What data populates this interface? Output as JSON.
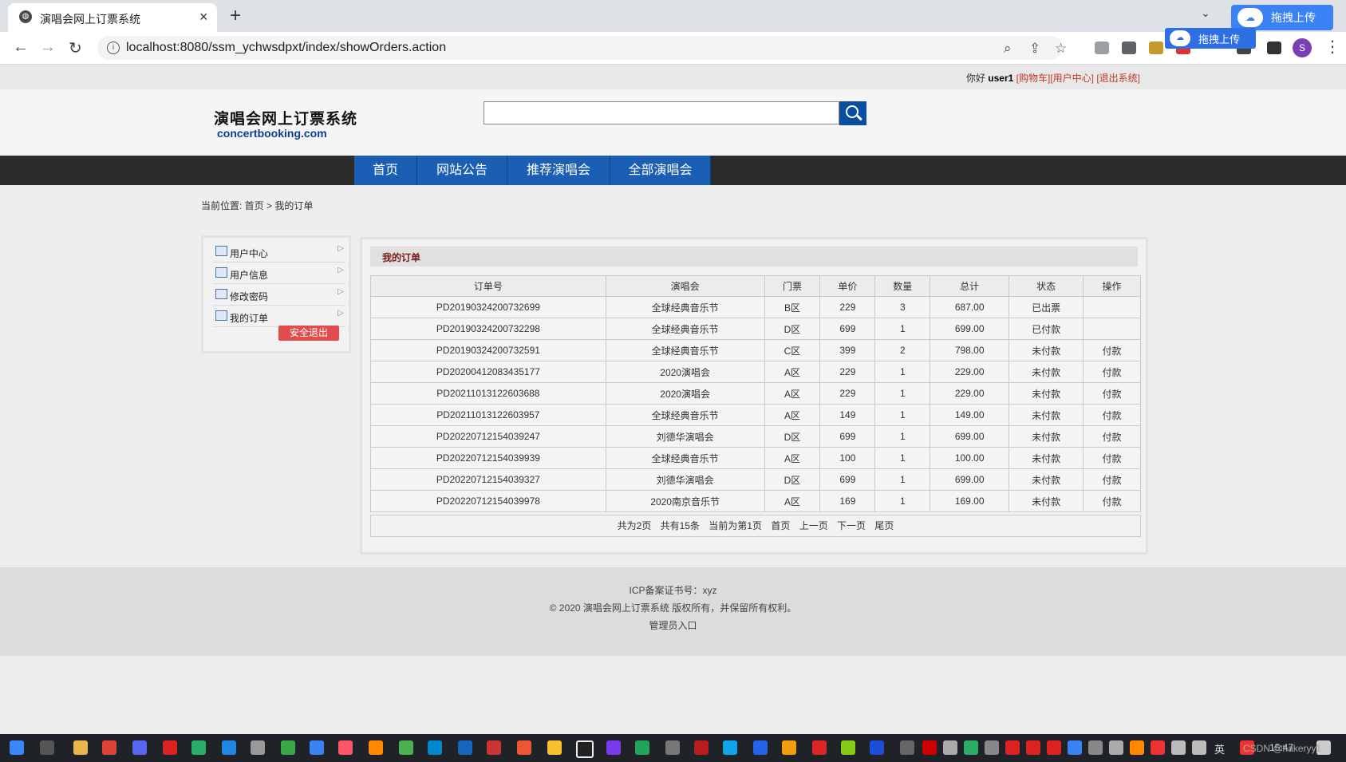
{
  "browser": {
    "tab_title": "演唱会网上订票系统",
    "url": "localhost:8080/ssm_ychwsdpxt/index/showOrders.action",
    "cloud_upload_label": "拖拽上传",
    "profile_initial": "S"
  },
  "site": {
    "greeting_prefix": "你好",
    "username": "user1",
    "links": [
      "[购物车]",
      "[用户中心]",
      "[退出系统]"
    ],
    "logo_cn": "演唱会网上订票系统",
    "logo_en": "concertbooking.com",
    "nav": [
      "首页",
      "网站公告",
      "推荐演唱会",
      "全部演唱会"
    ],
    "breadcrumb": "当前位置: 首页 > 我的订单"
  },
  "sidebar": {
    "items": [
      "用户中心",
      "用户信息",
      "修改密码",
      "我的订单"
    ],
    "logout": "安全退出"
  },
  "orders": {
    "heading": "我的订单",
    "columns": [
      "订单号",
      "演唱会",
      "门票",
      "单价",
      "数量",
      "总计",
      "状态",
      "操作"
    ],
    "rows": [
      [
        "PD20190324200732699",
        "全球经典音乐节",
        "B区",
        "229",
        "3",
        "687.00",
        "已出票",
        ""
      ],
      [
        "PD20190324200732298",
        "全球经典音乐节",
        "D区",
        "699",
        "1",
        "699.00",
        "已付款",
        ""
      ],
      [
        "PD20190324200732591",
        "全球经典音乐节",
        "C区",
        "399",
        "2",
        "798.00",
        "未付款",
        "付款"
      ],
      [
        "PD20200412083435177",
        "2020演唱会",
        "A区",
        "229",
        "1",
        "229.00",
        "未付款",
        "付款"
      ],
      [
        "PD20211013122603688",
        "2020演唱会",
        "A区",
        "229",
        "1",
        "229.00",
        "未付款",
        "付款"
      ],
      [
        "PD20211013122603957",
        "全球经典音乐节",
        "A区",
        "149",
        "1",
        "149.00",
        "未付款",
        "付款"
      ],
      [
        "PD20220712154039247",
        "刘德华演唱会",
        "D区",
        "699",
        "1",
        "699.00",
        "未付款",
        "付款"
      ],
      [
        "PD20220712154039939",
        "全球经典音乐节",
        "A区",
        "100",
        "1",
        "100.00",
        "未付款",
        "付款"
      ],
      [
        "PD20220712154039327",
        "刘德华演唱会",
        "D区",
        "699",
        "1",
        "699.00",
        "未付款",
        "付款"
      ],
      [
        "PD20220712154039978",
        "2020南京音乐节",
        "A区",
        "169",
        "1",
        "169.00",
        "未付款",
        "付款"
      ]
    ],
    "pager": [
      "共为2页",
      "共有15条",
      "当前为第1页",
      "首页",
      "上一页",
      "下一页",
      "尾页"
    ]
  },
  "footer": {
    "icp": "ICP备案证书号：xyz",
    "copyright": "© 2020 演唱会网上订票系统 版权所有，并保留所有权利。",
    "admin": "管理员入口"
  },
  "taskbar": {
    "lang": "英",
    "time": "15:47",
    "watermark": "CSDN @hakeryy1"
  }
}
